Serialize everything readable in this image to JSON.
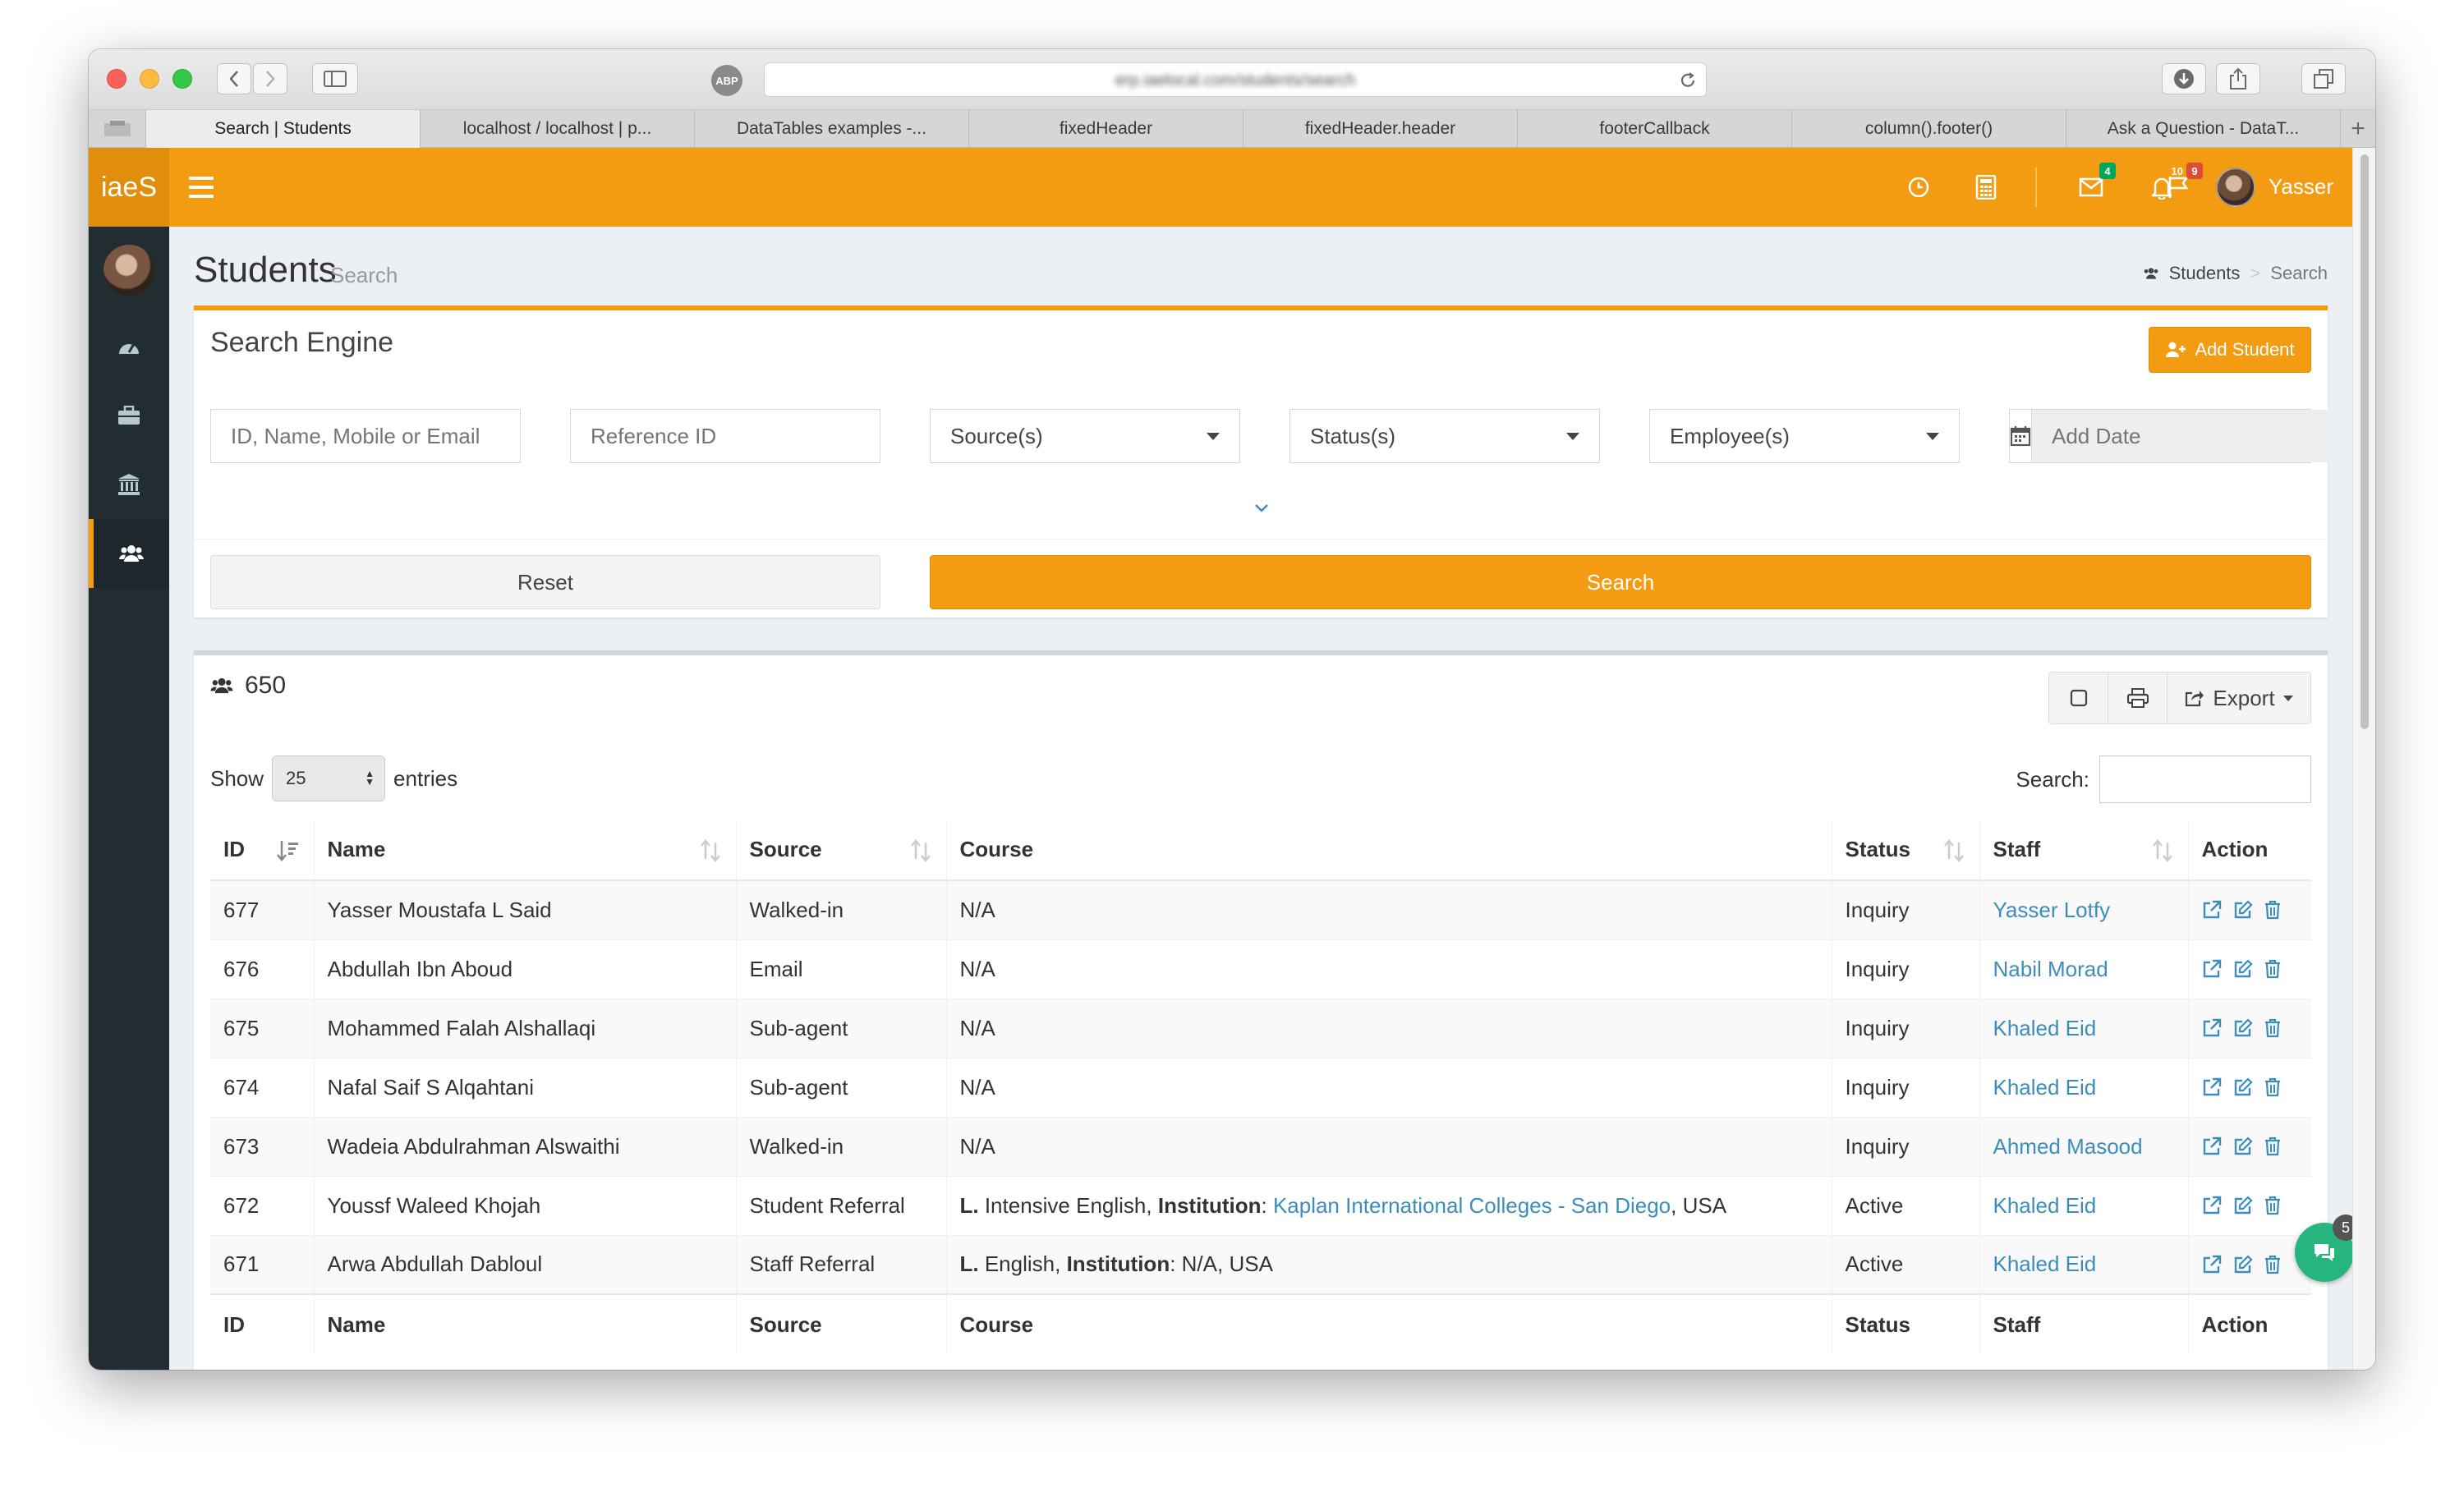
{
  "browser": {
    "url": "erp.iaelocal.com/students/search",
    "tabs": [
      "Search | Students",
      "localhost / localhost | p...",
      "DataTables examples -...",
      "fixedHeader",
      "fixedHeader.header",
      "footerCallback",
      "column().footer()",
      "Ask a Question - DataT..."
    ],
    "tab_add": "+"
  },
  "header": {
    "logo": "iaeS",
    "user_name": "Yasser",
    "badges": {
      "mail": "4",
      "bell": "10",
      "flag": "9"
    },
    "colors": {
      "primary": "#f39c12",
      "sidebar": "#222d32",
      "link": "#3c8dbc",
      "green_badge": "#00a65a",
      "yellow_badge": "#f39c12",
      "red_badge": "#dd4b39"
    }
  },
  "sidebar": {
    "icons": [
      "dashboard-icon",
      "briefcase-icon",
      "institution-icon",
      "users-icon"
    ],
    "active": "users-icon"
  },
  "page": {
    "title": "Students",
    "subtitle": "Search",
    "breadcrumb": [
      "Students",
      "Search"
    ]
  },
  "search_engine": {
    "title": "Search Engine",
    "add_student": "Add Student",
    "placeholders": {
      "query": "ID, Name, Mobile or Email",
      "reference": "Reference ID",
      "date": "Add Date"
    },
    "selects": {
      "source": "Source(s)",
      "status": "Status(s)",
      "employee": "Employee(s)"
    },
    "reset": "Reset",
    "search": "Search"
  },
  "results": {
    "count": "650",
    "export": "Export",
    "show_label": "Show",
    "entries_value": "25",
    "entries_label": "entries",
    "search_label": "Search:",
    "columns": [
      "ID",
      "Name",
      "Source",
      "Course",
      "Status",
      "Staff",
      "Action"
    ],
    "rows": [
      {
        "id": "677",
        "name": "Yasser Moustafa L Said",
        "source": "Walked-in",
        "course": {
          "plain": "N/A"
        },
        "status": "Inquiry",
        "staff": "Yasser Lotfy"
      },
      {
        "id": "676",
        "name": "Abdullah Ibn Aboud",
        "source": "Email",
        "course": {
          "plain": "N/A"
        },
        "status": "Inquiry",
        "staff": "Nabil Morad"
      },
      {
        "id": "675",
        "name": "Mohammed Falah Alshallaqi",
        "source": "Sub-agent",
        "course": {
          "plain": "N/A"
        },
        "status": "Inquiry",
        "staff": "Khaled Eid"
      },
      {
        "id": "674",
        "name": "Nafal Saif S Alqahtani",
        "source": "Sub-agent",
        "course": {
          "plain": "N/A"
        },
        "status": "Inquiry",
        "staff": "Khaled Eid"
      },
      {
        "id": "673",
        "name": "Wadeia Abdulrahman Alswaithi",
        "source": "Walked-in",
        "course": {
          "plain": "N/A"
        },
        "status": "Inquiry",
        "staff": "Ahmed Masood"
      },
      {
        "id": "672",
        "name": "Youssf Waleed Khojah",
        "source": "Student Referral",
        "course": {
          "prefix": "L.",
          "program": " Intensive English, ",
          "inst_label": "Institution",
          "sep": ": ",
          "institution": "Kaplan International Colleges - San Diego",
          "country": ", USA"
        },
        "status": "Active",
        "staff": "Khaled Eid"
      },
      {
        "id": "671",
        "name": "Arwa Abdullah Dabloul",
        "source": "Staff Referral",
        "course": {
          "prefix": "L.",
          "program": " English, ",
          "inst_label": "Institution",
          "sep": ": ",
          "institution_plain": "N/A",
          "country": ", USA"
        },
        "status": "Active",
        "staff": "Khaled Eid"
      }
    ]
  },
  "chat": {
    "badge": "5"
  }
}
